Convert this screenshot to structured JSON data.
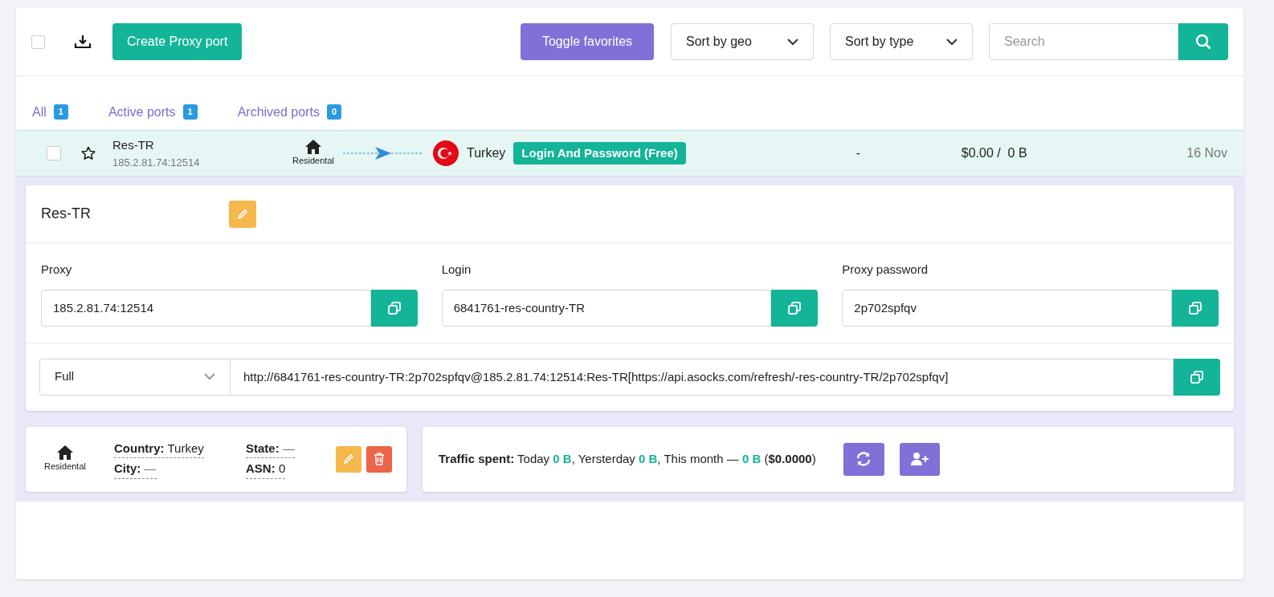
{
  "toolbar": {
    "select_all": {
      "checked": false
    },
    "create_button": "Create Proxy port",
    "toggle_favorites": "Toggle favorites",
    "sort_geo": "Sort by geo",
    "sort_type": "Sort by type",
    "search": {
      "placeholder": "Search"
    }
  },
  "tabs": [
    {
      "label": "All",
      "count": "1"
    },
    {
      "label": "Active ports",
      "count": "1"
    },
    {
      "label": "Archived ports",
      "count": "0"
    }
  ],
  "port": {
    "checked": false,
    "favorite": false,
    "name": "Res-TR",
    "address": "185.2.81.74:12514",
    "type": "Residental",
    "country": "Turkey",
    "auth_badge": "Login And Password (Free)",
    "column_5": "-",
    "cost": "$0.00 /  0 B",
    "date": "16 Nov"
  },
  "details": {
    "name": "Res-TR",
    "fields": [
      {
        "label": "Proxy",
        "value": "185.2.81.74:12514"
      },
      {
        "label": "Login",
        "value": "6841761-res-country-TR"
      },
      {
        "label": "Proxy password",
        "value": "2p702spfqv"
      }
    ],
    "format": "Full",
    "connection_string": "http://6841761-res-country-TR:2p702spfqv@185.2.81.74:12514:Res-TR[https://api.asocks.com/refresh/-res-country-TR/2p702spfqv]"
  },
  "info": {
    "type": "Residental",
    "country_label": "Country:",
    "country": "Turkey",
    "city_label": "City:",
    "city": "—",
    "state_label": "State:",
    "state": "—",
    "asn_label": "ASN:",
    "asn": "0"
  },
  "traffic": [
    {
      "kind": "bold",
      "text": "Traffic spent:"
    },
    {
      "kind": "plain",
      "text": " Today "
    },
    {
      "kind": "value",
      "text": "0 B"
    },
    {
      "kind": "plain",
      "text": ", Yersterday "
    },
    {
      "kind": "value",
      "text": "0 B"
    },
    {
      "kind": "plain",
      "text": ", This month — "
    },
    {
      "kind": "value",
      "text": "0 B"
    },
    {
      "kind": "plain",
      "text": " ("
    },
    {
      "kind": "bold",
      "text": "$0.0000"
    },
    {
      "kind": "plain",
      "text": ")"
    }
  ]
}
